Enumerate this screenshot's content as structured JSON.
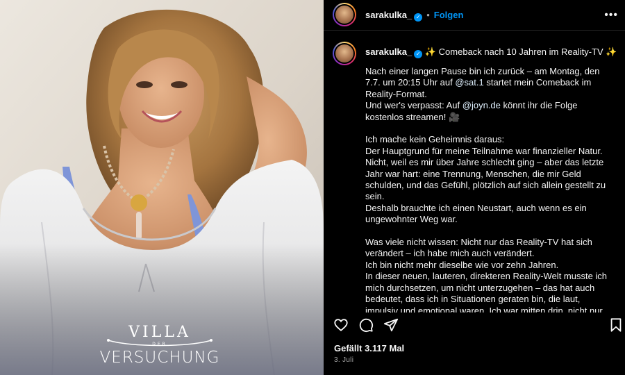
{
  "header": {
    "username": "sarakulka_",
    "dot": "•",
    "follow_label": "Folgen",
    "more_label": "•••"
  },
  "caption": {
    "username": "sarakulka_",
    "title": "✨ Comeback nach 10 Jahren im Reality-TV ✨",
    "p1a": "Nach einer langen Pause bin ich zurück – am Montag, den 7.7. um 20:15 Uhr auf ",
    "mention_sat": "@sat.1",
    "p1b": " startet mein Comeback im Reality-Format.",
    "p2a": "Und wer's verpasst: Auf ",
    "mention_joyn": "@joyn.de",
    "p2b": " könnt ihr die Folge kostenlos streamen! 🎥",
    "p3": "Ich mache kein Geheimnis daraus:",
    "p4": "Der Hauptgrund für meine Teilnahme war finanzieller Natur. Nicht, weil es mir über Jahre schlecht ging – aber das letzte Jahr war hart: eine Trennung, Menschen, die mir Geld schulden, und das Gefühl, plötzlich auf sich allein gestellt zu sein.",
    "p5": "Deshalb brauchte ich einen Neustart, auch wenn es ein ungewohnter Weg war.",
    "p6": "Was viele nicht wissen: Nicht nur das Reality-TV hat sich verändert – ich habe mich auch verändert.",
    "p7": "Ich bin nicht mehr dieselbe wie vor zehn Jahren.",
    "p8": "In dieser neuen, lauteren, direkteren Reality-Welt musste ich mich durchsetzen, um nicht unterzugehen – das hat auch bedeutet, dass ich in Situationen geraten bin, die laut, impulsiv und emotional waren. Ich war mitten drin, nicht nur"
  },
  "media": {
    "logo_line1": "VILLA",
    "logo_line2": "DER",
    "logo_line3": "VERSUCHUNG"
  },
  "actions": {
    "icons": [
      "heart-icon",
      "comment-icon",
      "share-icon",
      "bookmark-icon"
    ]
  },
  "likes": "Gefällt 3.117 Mal",
  "date": "3. Juli",
  "colors": {
    "background": "#000000",
    "accent": "#0095f6",
    "mention": "#e0f1ff",
    "muted": "#a8a8a8"
  }
}
